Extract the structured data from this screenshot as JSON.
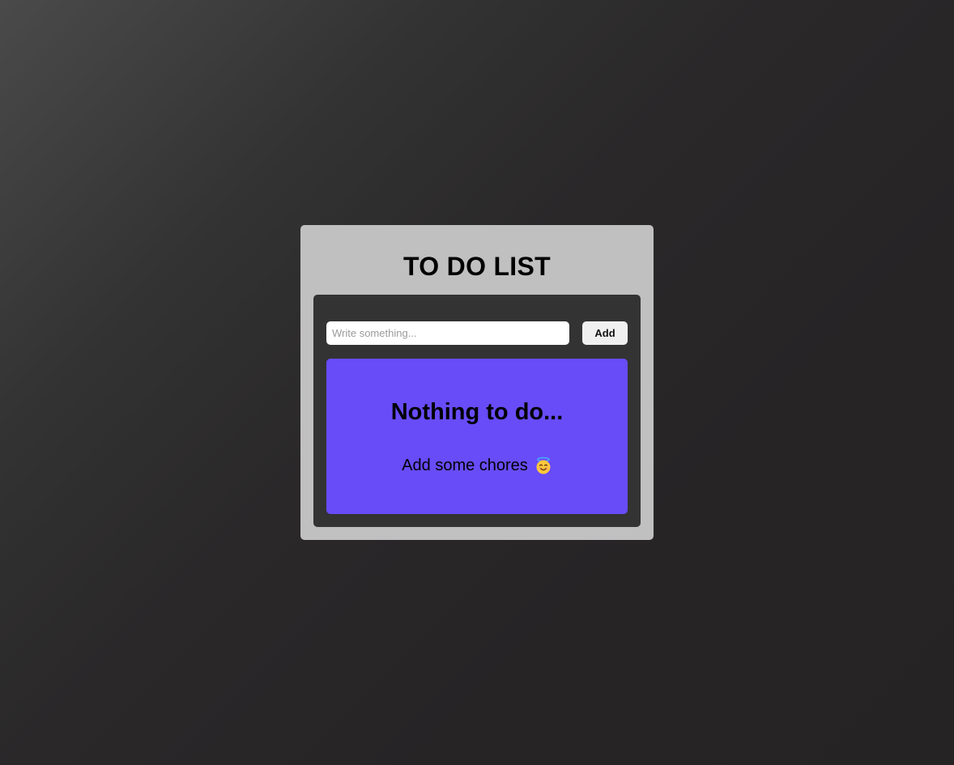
{
  "app": {
    "title": "TO DO LIST"
  },
  "input": {
    "placeholder": "Write something...",
    "value": ""
  },
  "add_button": {
    "label": "Add"
  },
  "empty_state": {
    "heading": "Nothing to do...",
    "message": "Add some chores",
    "icon": "smiling-face-with-halo-icon"
  },
  "colors": {
    "card_background": "#c0c0c0",
    "panel_background": "#333333",
    "empty_state_background": "#674cf8",
    "button_background": "#f0f0f0"
  }
}
